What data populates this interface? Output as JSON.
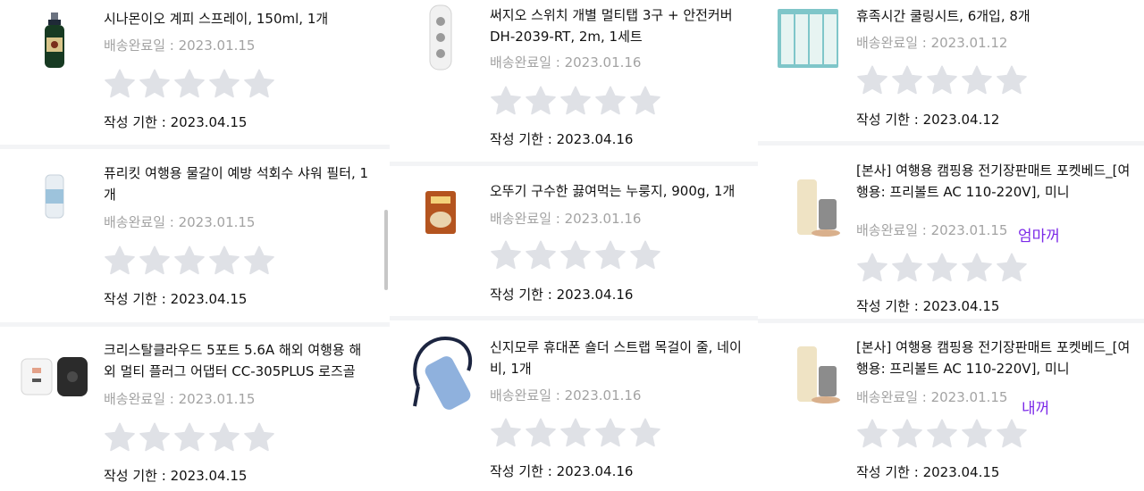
{
  "labels": {
    "delivered_prefix": "배송완료일 : ",
    "deadline_prefix": "작성 기한 : "
  },
  "colors": {
    "star": "#dfe1e6",
    "note": "#7c2ae8",
    "muted": "#a3a3a3"
  },
  "items": [
    {
      "title": "시나몬이오 계피 스프레이, 150ml, 1개",
      "delivered": "2023.01.15",
      "deadline": "2023.04.15",
      "rating": 0
    },
    {
      "title": "퓨리킷 여행용 물갈이 예방 석회수 샤워 필터, 1개",
      "delivered": "2023.01.15",
      "deadline": "2023.04.15",
      "rating": 0
    },
    {
      "title": "크리스탈클라우드 5포트 5.6A 해외 여행용 해외 멀티 플러그 어댑터 CC-305PLUS 로즈골",
      "delivered": "2023.01.15",
      "deadline": "2023.04.15",
      "rating": 0
    },
    {
      "title": "써지오 스위치 개별 멀티탭 3구 + 안전커버 DH-2039-RT, 2m, 1세트",
      "delivered": "2023.01.16",
      "deadline": "2023.04.16",
      "rating": 0
    },
    {
      "title": "오뚜기 구수한 끓여먹는 누룽지, 900g, 1개",
      "delivered": "2023.01.16",
      "deadline": "2023.04.16",
      "rating": 0
    },
    {
      "title": "신지모루 휴대폰 숄더 스트랩 목걸이 줄, 네이비, 1개",
      "delivered": "2023.01.16",
      "deadline": "2023.04.16",
      "rating": 0
    },
    {
      "title": "휴족시간 쿨링시트, 6개입, 8개",
      "delivered": "2023.01.12",
      "deadline": "2023.04.12",
      "rating": 0
    },
    {
      "title": "[본사] 여행용 캠핑용 전기장판매트 포켓베드_[여행용: 프리볼트 AC 110-220V], 미니",
      "delivered": "2023.01.15",
      "deadline": "2023.04.15",
      "rating": 0,
      "note": "엄마꺼"
    },
    {
      "title": "[본사] 여행용 캠핑용 전기장판매트 포켓베드_[여행용: 프리볼트 AC 110-220V], 미니",
      "delivered": "2023.01.15",
      "deadline": "2023.04.15",
      "rating": 0,
      "note": "내꺼"
    }
  ]
}
